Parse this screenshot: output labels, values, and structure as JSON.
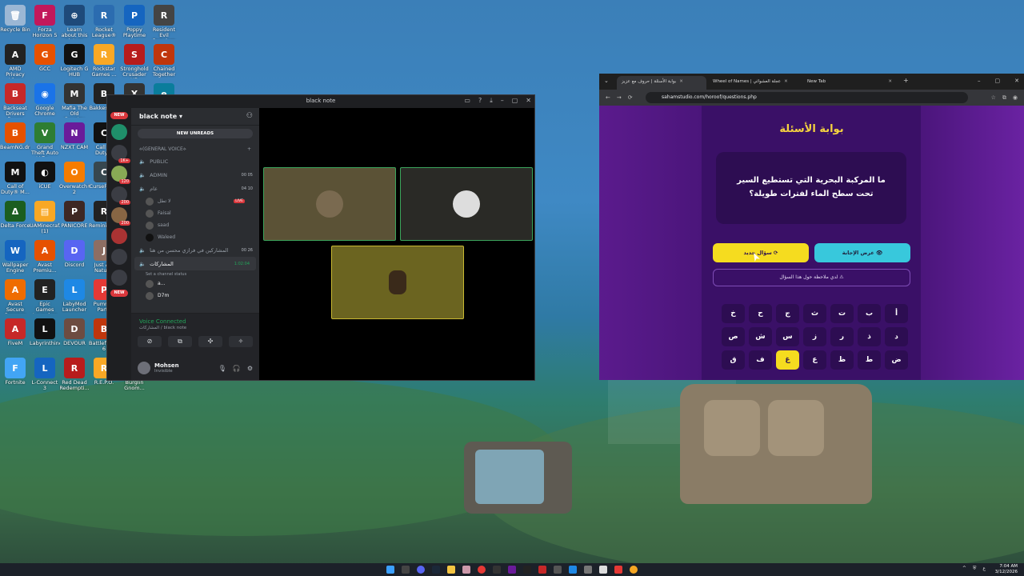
{
  "desktop": {
    "icons": [
      {
        "label": "Recycle Bin",
        "color": "#9bb7d4",
        "glyph": "🗑"
      },
      {
        "label": "Forza Horizon 5",
        "color": "#c2185b",
        "glyph": "F"
      },
      {
        "label": "Learn about this picture",
        "color": "#1e4a7a",
        "glyph": "⊕"
      },
      {
        "label": "Rocket League®",
        "color": "#2b6cb0",
        "glyph": "R"
      },
      {
        "label": "Poppy Playtime",
        "color": "#1565c0",
        "glyph": "P"
      },
      {
        "label": "Resident Evil Requiem",
        "color": "#444",
        "glyph": "R"
      },
      {
        "label": "AMD Privacy View",
        "color": "#222",
        "glyph": "A"
      },
      {
        "label": "GCC",
        "color": "#e65100",
        "glyph": "G"
      },
      {
        "label": "Logitech G HUB",
        "color": "#111",
        "glyph": "G"
      },
      {
        "label": "Rockstar Games ...",
        "color": "#f9a825",
        "glyph": "R"
      },
      {
        "label": "Stronghold Crusader HD",
        "color": "#b71c1c",
        "glyph": "S"
      },
      {
        "label": "Chained Together",
        "color": "#bf360c",
        "glyph": "C"
      },
      {
        "label": "Backseat Drivers Demo",
        "color": "#c62828",
        "glyph": "B"
      },
      {
        "label": "Google Chrome",
        "color": "#1a73e8",
        "glyph": "◉"
      },
      {
        "label": "Mafia The Old Country",
        "color": "#333",
        "glyph": "M"
      },
      {
        "label": "BakkesMod",
        "color": "#222",
        "glyph": "B"
      },
      {
        "label": "GoXLR App",
        "color": "#333",
        "glyph": "X"
      },
      {
        "label": "Microsoft Edge",
        "color": "#0a7d9c",
        "glyph": "e"
      },
      {
        "label": "BeamNG.dri...",
        "color": "#e65100",
        "glyph": "B"
      },
      {
        "label": "Grand Theft Auto V En...",
        "color": "#2e7d32",
        "glyph": "V"
      },
      {
        "label": "NZXT CAM",
        "color": "#6a1b9a",
        "glyph": "N"
      },
      {
        "label": "Call of Duty®",
        "color": "#111",
        "glyph": "C"
      },
      {
        "label": "Grand Theft Auto V Le...",
        "color": "#2e7d32",
        "glyph": "V"
      },
      {
        "label": "OBS Studio",
        "color": "#222",
        "glyph": "◎"
      },
      {
        "label": "Call of Duty® M...",
        "color": "#111",
        "glyph": "M"
      },
      {
        "label": "iCUE",
        "color": "#111",
        "glyph": "◐"
      },
      {
        "label": "Overwatch® 2",
        "color": "#f57c00",
        "glyph": "O"
      },
      {
        "label": "CurseForge",
        "color": "#37474f",
        "glyph": "C"
      },
      {
        "label": "UAMinecraf...",
        "color": "#f9a825",
        "glyph": "▤"
      },
      {
        "label": "Overwolf",
        "color": "#333",
        "glyph": "W"
      },
      {
        "label": "Delta Force",
        "color": "#1b5e20",
        "glyph": "Δ"
      },
      {
        "label": "UAMinecraf... (1)",
        "color": "#f9a825",
        "glyph": "▤"
      },
      {
        "label": "PANICORE",
        "color": "#3e2723",
        "glyph": "P"
      },
      {
        "label": "Reminisce...",
        "color": "#222",
        "glyph": "R"
      },
      {
        "label": "Iriun Webcam",
        "color": "#0d47a1",
        "glyph": "Q"
      },
      {
        "label": "PlayInArabi...",
        "color": "#eee",
        "glyph": "▯"
      },
      {
        "label": "Wallpaper Engine",
        "color": "#1565c0",
        "glyph": "W"
      },
      {
        "label": "Avast Premiu...",
        "color": "#e65100",
        "glyph": "A"
      },
      {
        "label": "Discord",
        "color": "#5865f2",
        "glyph": "D"
      },
      {
        "label": "Just Act Natural",
        "color": "#8d6e63",
        "glyph": "J"
      },
      {
        "label": "POISON_1...",
        "color": "#f9a825",
        "glyph": "▤"
      },
      {
        "label": "Five Nights at Freddy's",
        "color": "#4e342e",
        "glyph": "F"
      },
      {
        "label": "Avast Secure Browser",
        "color": "#ef6c00",
        "glyph": "A"
      },
      {
        "label": "Epic Games Launcher",
        "color": "#222",
        "glyph": "E"
      },
      {
        "label": "LabyMod Launcher",
        "color": "#1e88e5",
        "glyph": "L"
      },
      {
        "label": "Pummel Party",
        "color": "#e53935",
        "glyph": "P"
      },
      {
        "label": "ملف RDR2الاحترافي",
        "color": "#f9a825",
        "glyph": "▤"
      },
      {
        "label": "Avast AntiTrack",
        "color": "#ef6c00",
        "glyph": "A"
      },
      {
        "label": "FiveM",
        "color": "#c62828",
        "glyph": "A"
      },
      {
        "label": "Labyrinthine",
        "color": "#111",
        "glyph": "L"
      },
      {
        "label": "DEVOUR",
        "color": "#6d4c41",
        "glyph": "D"
      },
      {
        "label": "Battlefield™ 6",
        "color": "#bf360c",
        "glyph": "B"
      },
      {
        "label": "Avast Cleanu...",
        "color": "#ef6c00",
        "glyph": "A"
      },
      {
        "label": "Fortnite",
        "color": "#42a5f5",
        "glyph": "F"
      },
      {
        "label": "L-Connect 3",
        "color": "#1565c0",
        "glyph": "L"
      },
      {
        "label": "Red Dead Redempti...",
        "color": "#b71c1c",
        "glyph": "R"
      },
      {
        "label": "R.E.P.O.",
        "color": "#f9a825",
        "glyph": "R"
      },
      {
        "label": "Burglin Gnom...",
        "color": "#6a1b1a",
        "glyph": "B"
      }
    ]
  },
  "discord": {
    "window_title": "black note",
    "server_name": "black note",
    "new_unreads": "NEW UNREADS",
    "rail_new": "NEW",
    "rail_new2": "NEW",
    "category": "⟡(GENERAL VOICE⟡",
    "channels": [
      {
        "name": "PUBLIC",
        "right": ""
      },
      {
        "name": "ADMIN",
        "right": "00  05"
      },
      {
        "name": "عام",
        "right": "04  10"
      }
    ],
    "users": [
      {
        "name": "لا تطل",
        "badge": "LIVE"
      },
      {
        "name": "Faisal",
        "badge": ""
      },
      {
        "name": "saad",
        "badge": ""
      },
      {
        "name": "Waleed",
        "badge": ""
      }
    ],
    "channel_long": "المشاركين في فرازي محسن من هنا",
    "channel_long_right": "00  26",
    "active_channel": "المشاركات",
    "active_time": "1:02:04",
    "active_status": "Set a channel status",
    "members": [
      "a...",
      "D7m"
    ],
    "voice_connected": "Voice Connected",
    "voice_sub": "المشاركات / black note",
    "user_name": "Mohsen",
    "user_status": "Invisible"
  },
  "browser": {
    "tabs": [
      {
        "label": "بوابة الأسئلة | حروف مع عزيز"
      },
      {
        "label": "Wheel of Names | عجلة العشوائي"
      },
      {
        "label": "New Tab"
      }
    ],
    "url": "sahamstudio.com/horoof/questions.php",
    "page_title": "بوابة الأسئلة",
    "question": "ما المركبة البحرية التي تستطيع السير تحت سطح الماء لفترات طويلة؟",
    "btn_new": "سؤال جديد ⟳",
    "btn_show": "عرض الإجابة 👁",
    "note": "لدي ملاحظة حول هذا السؤال ⚠",
    "keys": [
      "أ",
      "ب",
      "ت",
      "ث",
      "ج",
      "ح",
      "خ",
      "د",
      "ذ",
      "ر",
      "ز",
      "س",
      "ش",
      "ص",
      "ض",
      "ط",
      "ظ",
      "ع",
      "غ",
      "ف",
      "ق"
    ],
    "highlighted_key": "غ"
  },
  "taskbar": {
    "time": "7:04 AM",
    "date": "3/12/2026",
    "lang": "ع",
    "tray": [
      "^",
      "⛨",
      "ع"
    ]
  }
}
